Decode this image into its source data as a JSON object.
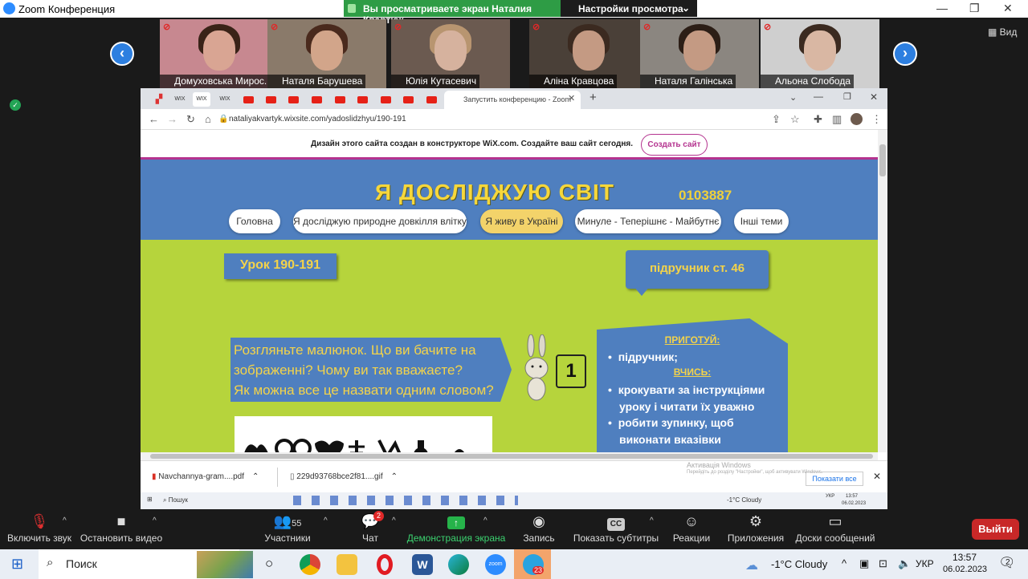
{
  "zoom": {
    "window_title": "Zoom Конференция",
    "share_banner": "Вы просматриваете экран Наталия Квартюк",
    "view_settings": "Настройки просмотра",
    "view_label": "Вид",
    "leave": "Выйти"
  },
  "participants": [
    {
      "name": "Домуховська Мирос...",
      "bg": "#c78890",
      "face": "#d9a593",
      "hair": "#3a2318"
    },
    {
      "name": "Наталя Барушева",
      "bg": "#8a7a6a",
      "face": "#d2a58a",
      "hair": "#4a2a1d"
    },
    {
      "name": "Юлія Кутасевич",
      "bg": "#6b5a50",
      "face": "#d6b29e",
      "hair": "#b89570"
    },
    {
      "name": "Аліна Кравцова",
      "bg": "#4a4038",
      "face": "#c49a83",
      "hair": "#3b2a20"
    },
    {
      "name": "Наталя Галінська",
      "bg": "#8b8680",
      "face": "#c49a83",
      "hair": "#2c1e16"
    },
    {
      "name": "Альона Слобода",
      "bg": "#cfcfcf",
      "face": "#d9b7a3",
      "hair": "#3b2a20"
    }
  ],
  "browser": {
    "tab_title": "Запустить конференцию - Zoom",
    "url": "nataliyakvartyk.wixsite.com/yadoslidzhyu/190-191",
    "wix_banner": "Дизайн этого сайта создан в конструкторе WiX.com. Создайте ваш сайт сегодня.",
    "wix_button": "Создать сайт"
  },
  "site": {
    "title": "Я ДОСЛІДЖУЮ СВІТ",
    "code": "0103887",
    "nav": [
      "Головна",
      "Я досліджую природне довкілля влітку",
      "Я живу в Україні",
      "Минуле - Теперішнє - Майбутнє",
      "Інші теми"
    ],
    "lesson": "Урок 190-191",
    "textbook": "підручник ст. 46",
    "question_lines": [
      "Розгляньте малюнок. Що ви бачите на",
      "зображенні? Чому ви так вважаєте?",
      "Як можна все це назвати одним словом?"
    ],
    "step_number": "1",
    "prepare_heading": "ПРИГОТУЙ:",
    "prepare_item": "підручник;",
    "learn_heading": "ВЧИСЬ:",
    "learn_items": [
      "крокувати за інструкціями",
      "уроку і читати їх уважно",
      "робити зупинку, щоб",
      "виконати вказівки"
    ]
  },
  "downloads": {
    "file1": "Navchannya-gram....pdf",
    "file2": "229d93768bce2f81....gif",
    "activate": "Активація Windows",
    "activate_sub": "Перейдіть до розділу \"Настройки\", щоб активувати Windows.",
    "show_all": "Показати все",
    "inner_search": "Пошук",
    "inner_weather": "-1°C  Cloudy",
    "inner_lang": "УКР",
    "inner_time": "13:57",
    "inner_date": "06.02.2023"
  },
  "toolbar": {
    "mute": "Включить звук",
    "video": "Остановить видео",
    "participants": "Участники",
    "participants_count": "55",
    "chat": "Чат",
    "chat_badge": "2",
    "share": "Демонстрация экрана",
    "record": "Запись",
    "captions": "Показать субтитры",
    "reactions": "Реакции",
    "apps": "Приложения",
    "whiteboard": "Доски сообщений"
  },
  "taskbar": {
    "search": "Поиск",
    "weather": "-1°C  Cloudy",
    "lang": "УКР",
    "time": "13:57",
    "date": "06.02.2023",
    "notif": "2",
    "telegram_badge": "23"
  }
}
